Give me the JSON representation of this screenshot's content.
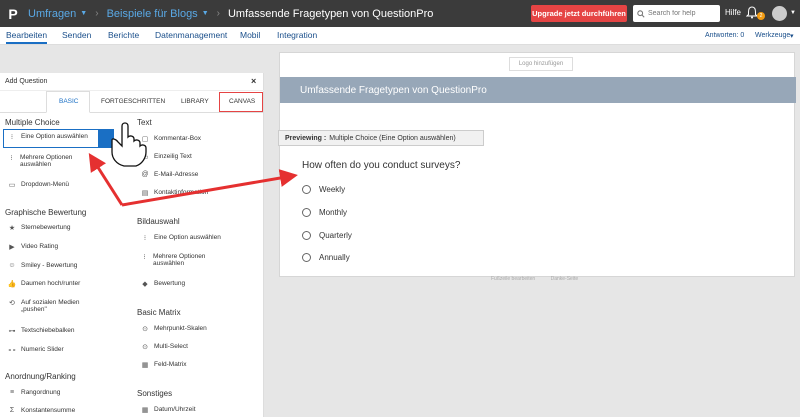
{
  "topbar": {
    "crumbs": [
      "Umfragen",
      "Beispiele für Blogs",
      "Umfassende Fragetypen von QuestionPro"
    ],
    "upgrade_label": "Upgrade jetzt durchführen",
    "search_placeholder": "Search for help",
    "help_label": "Hilfe",
    "notification_count": "2"
  },
  "subnav": {
    "tabs": [
      "Bearbeiten",
      "Senden",
      "Berichte",
      "Datenmanagement",
      "Mobil",
      "Integration"
    ],
    "responses_label": "Antworten: 0",
    "tools_label": "Werkzeuge"
  },
  "panel": {
    "title": "Add Question",
    "close": "×",
    "tabs": [
      "BASIC",
      "FORTGESCHRITTEN",
      "LIBRARY",
      "CANVAS"
    ],
    "col1": {
      "multiple_choice": {
        "heading": "Multiple Choice",
        "items": [
          "Eine Option auswählen",
          "Mehrere Optionen auswählen",
          "Dropdown-Menü"
        ]
      },
      "rating": {
        "heading": "Graphische Bewertung",
        "items": [
          "Sternebewertung",
          "Video Rating",
          "Smiley - Bewertung",
          "Daumen hoch/runter",
          "Auf sozialen Medien „pushen\"",
          "Textschiebebalken",
          "Numeric Slider"
        ]
      },
      "ranking": {
        "heading": "Anordnung/Ranking",
        "items": [
          "Rangordnung",
          "Konstantensumme"
        ]
      }
    },
    "col2": {
      "text": {
        "heading": "Text",
        "items": [
          "Kommentar-Box",
          "Einzeilig Text",
          "E-Mail-Adresse",
          "Kontaktinformation"
        ]
      },
      "image": {
        "heading": "Bildauswahl",
        "items": [
          "Eine Option auswählen",
          "Mehrere Optionen auswählen",
          "Bewertung"
        ]
      },
      "matrix": {
        "heading": "Basic Matrix",
        "items": [
          "Mehrpunkt-Skalen",
          "Multi-Select",
          "Feld-Matrix"
        ]
      },
      "misc": {
        "heading": "Sonstiges",
        "items": [
          "Datum/Uhrzeit"
        ]
      }
    }
  },
  "canvas": {
    "logo_button": "Logo hinzufügen",
    "survey_title": "Umfassende Fragetypen von QuestionPro",
    "preview_prefix": "Previewing :",
    "preview_type": "Multiple Choice (Eine Option auswählen)",
    "question": "How often do you conduct surveys?",
    "options": [
      "Weekly",
      "Monthly",
      "Quarterly",
      "Annually"
    ],
    "footer_links": [
      "Fußzeile bearbeiten",
      "Danke-Seite"
    ]
  },
  "colors": {
    "accent": "#1a6fc4",
    "upgrade": "#e54444",
    "arrow": "#e53030",
    "band": "#97a7b8"
  }
}
